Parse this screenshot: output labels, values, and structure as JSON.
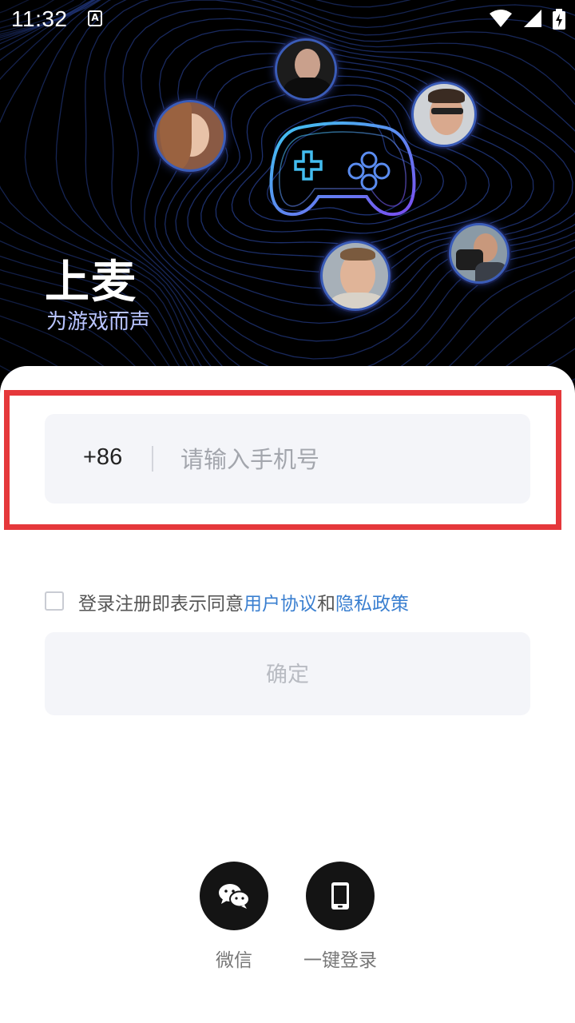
{
  "status_bar": {
    "time": "11:32",
    "notification_icon": "A",
    "icons": [
      "wifi-icon",
      "cellular-signal-icon",
      "battery-charging-icon"
    ]
  },
  "hero": {
    "title": "上麦",
    "slogan": "为游戏而声",
    "decoration": [
      "gamepad-icon",
      "avatar-woman",
      "avatar-man-dark",
      "avatar-man-glasses",
      "avatar-man-camera",
      "avatar-man-smiling"
    ]
  },
  "login": {
    "country_code": "+86",
    "phone_placeholder": "请输入手机号",
    "phone_value": "",
    "agreement_prefix": "登录注册即表示同意",
    "user_agreement_link": "用户协议",
    "agreement_and": "和",
    "privacy_policy_link": "隐私政策",
    "agreement_checked": false,
    "confirm_label": "确定"
  },
  "alt_login": {
    "wechat_label": "微信",
    "one_click_label": "一键登录"
  },
  "colors": {
    "accent_link": "#3a7fd0",
    "highlight_border": "#e5383b",
    "input_bg": "#f4f5f9",
    "hero_bg": "#000000",
    "wave_line": "#2d4aa8"
  }
}
